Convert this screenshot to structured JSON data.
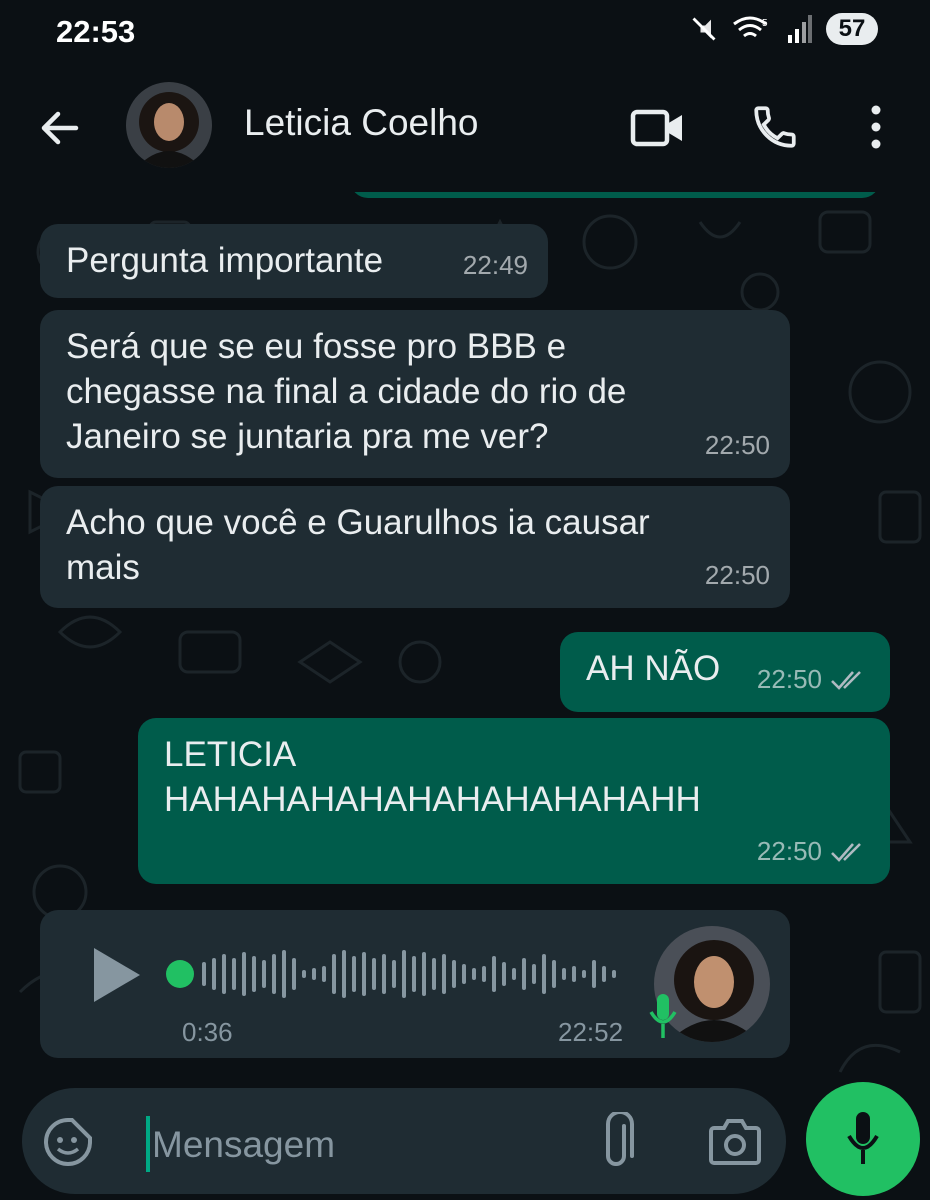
{
  "status_bar": {
    "time": "22:53",
    "battery": "57"
  },
  "header": {
    "contact_name": "Leticia Coelho"
  },
  "messages": [
    {
      "direction": "incoming",
      "text": "Pergunta importante",
      "time": "22:49"
    },
    {
      "direction": "incoming",
      "text": "Será que se eu fosse pro BBB e chegasse na final a cidade do rio de Janeiro se juntaria pra me ver?",
      "lines": [
        "Será que se eu fosse pro BBB e",
        "chegasse na final a cidade do rio de",
        "Janeiro se juntaria pra me ver?"
      ],
      "time": "22:50"
    },
    {
      "direction": "incoming",
      "text": "Acho que você e Guarulhos ia causar mais",
      "lines": [
        "Acho que você e Guarulhos ia causar",
        "mais"
      ],
      "time": "22:50"
    },
    {
      "direction": "outgoing",
      "text": "AH NÃO",
      "time": "22:50",
      "status": "read"
    },
    {
      "direction": "outgoing",
      "text": "LETICIA HAHAHAHAHAHAHAHAHAHAHH",
      "lines": [
        "LETICIA",
        "HAHAHAHAHAHAHAHAHAHAHH"
      ],
      "time": "22:50",
      "status": "read"
    }
  ],
  "voice_message": {
    "direction": "incoming",
    "duration": "0:36",
    "time": "22:52"
  },
  "composer": {
    "placeholder": "Mensagem"
  },
  "colors": {
    "incoming_bubble": "#1f2c33",
    "outgoing_bubble": "#005c4b",
    "accent_green": "#21c063",
    "background": "#0b1014"
  },
  "icons": [
    "back-arrow-icon",
    "video-call-icon",
    "phone-icon",
    "more-vert-icon",
    "play-icon",
    "mic-icon",
    "sticker-icon",
    "attach-icon",
    "camera-icon",
    "double-check-icon"
  ]
}
